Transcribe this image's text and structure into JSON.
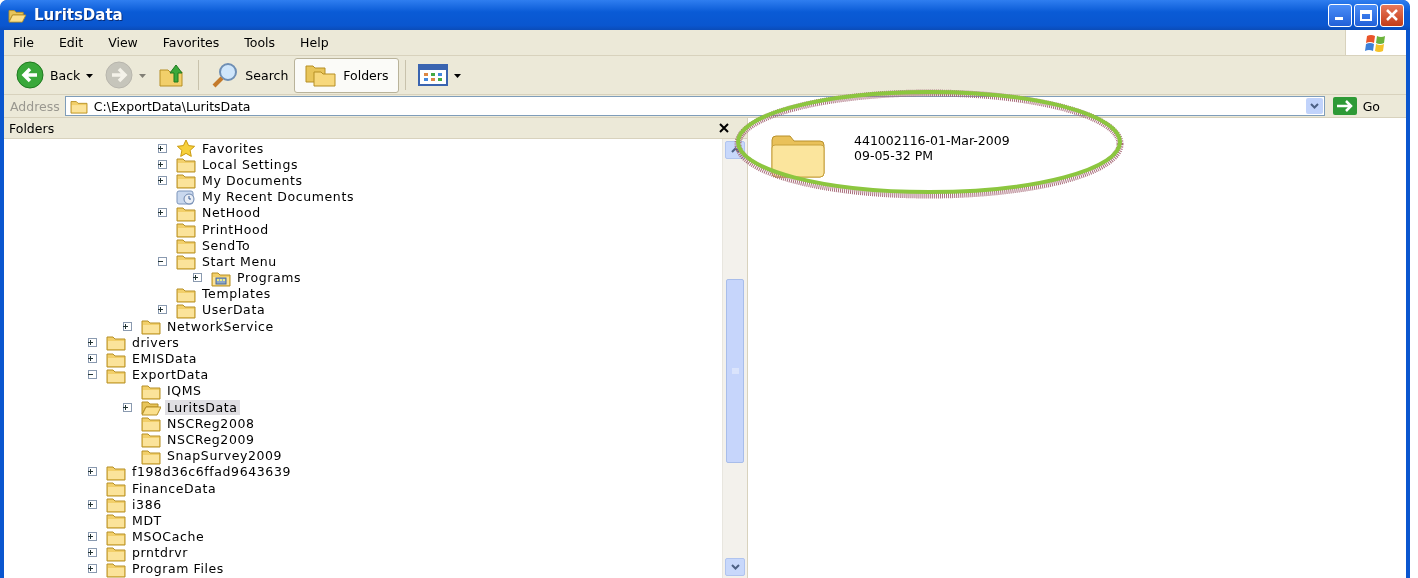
{
  "window": {
    "title": "LuritsData"
  },
  "menu": [
    "File",
    "Edit",
    "View",
    "Favorites",
    "Tools",
    "Help"
  ],
  "toolbar": [
    {
      "kind": "back",
      "label": "Back",
      "disabled": false,
      "on": false
    },
    {
      "kind": "forward",
      "disabled": true,
      "on": false
    },
    {
      "kind": "up",
      "disabled": false,
      "on": false
    },
    {
      "kind": "search",
      "label": "Search",
      "disabled": false,
      "on": false
    },
    {
      "kind": "folders",
      "label": "Folders",
      "disabled": false,
      "on": true
    },
    {
      "kind": "views",
      "disabled": false,
      "on": false
    }
  ],
  "address": {
    "label": "Address",
    "value": "C:\\ExportData\\LuritsData",
    "go": "Go"
  },
  "folders_pane": {
    "title": "Folders",
    "tree": [
      {
        "children": [
          {
            "children": [
              {
                "label": "Favorites",
                "kind": "favorites",
                "expanded": false,
                "selected": false
              },
              {
                "label": "Local Settings",
                "kind": "folder",
                "expanded": false,
                "selected": false
              },
              {
                "label": "My Documents",
                "kind": "folder",
                "expanded": false,
                "selected": false
              },
              {
                "label": "My Recent Documents",
                "kind": "recent",
                "selected": false
              },
              {
                "label": "NetHood",
                "kind": "folder",
                "expanded": false,
                "selected": false
              },
              {
                "label": "PrintHood",
                "kind": "folder",
                "selected": false
              },
              {
                "label": "SendTo",
                "kind": "folder",
                "selected": false
              },
              {
                "label": "Start Menu",
                "kind": "folder",
                "expanded": true,
                "selected": false,
                "children": [
                  {
                    "label": "Programs",
                    "kind": "programs",
                    "expanded": false,
                    "selected": false
                  }
                ]
              },
              {
                "label": "Templates",
                "kind": "folder",
                "selected": false
              },
              {
                "label": "UserData",
                "kind": "folder",
                "expanded": false,
                "selected": false
              }
            ]
          },
          {
            "label": "NetworkService",
            "kind": "folder",
            "expanded": false,
            "selected": false
          }
        ]
      },
      {
        "label": "drivers",
        "kind": "folder",
        "expanded": false,
        "selected": false
      },
      {
        "label": "EMISData",
        "kind": "folder",
        "expanded": false,
        "selected": false
      },
      {
        "label": "ExportData",
        "kind": "folder",
        "expanded": true,
        "selected": false,
        "children": [
          {
            "label": "IQMS",
            "kind": "folder",
            "selected": false
          },
          {
            "label": "LuritsData",
            "kind": "folder",
            "expanded": false,
            "selected": true
          },
          {
            "label": "NSCReg2008",
            "kind": "folder",
            "selected": false
          },
          {
            "label": "NSCReg2009",
            "kind": "folder",
            "selected": false
          },
          {
            "label": "SnapSurvey2009",
            "kind": "folder",
            "selected": false
          }
        ]
      },
      {
        "label": "f198d36c6ffad9643639",
        "kind": "folder",
        "expanded": false,
        "selected": false
      },
      {
        "label": "FinanceData",
        "kind": "folder",
        "selected": false
      },
      {
        "label": "i386",
        "kind": "folder",
        "expanded": false,
        "selected": false
      },
      {
        "label": "MDT",
        "kind": "folder",
        "selected": false
      },
      {
        "label": "MSOCache",
        "kind": "folder",
        "expanded": false,
        "selected": false
      },
      {
        "label": "prntdrvr",
        "kind": "folder",
        "expanded": false,
        "selected": false
      },
      {
        "label": "Program Files",
        "kind": "folder",
        "expanded": false,
        "selected": false
      }
    ]
  },
  "content": {
    "items": [
      {
        "name_lines": [
          "441002116-01-Mar-2009",
          "09-05-32 PM"
        ],
        "selected": false
      }
    ]
  },
  "annotations": [
    {
      "kind": "ellipse"
    }
  ]
}
